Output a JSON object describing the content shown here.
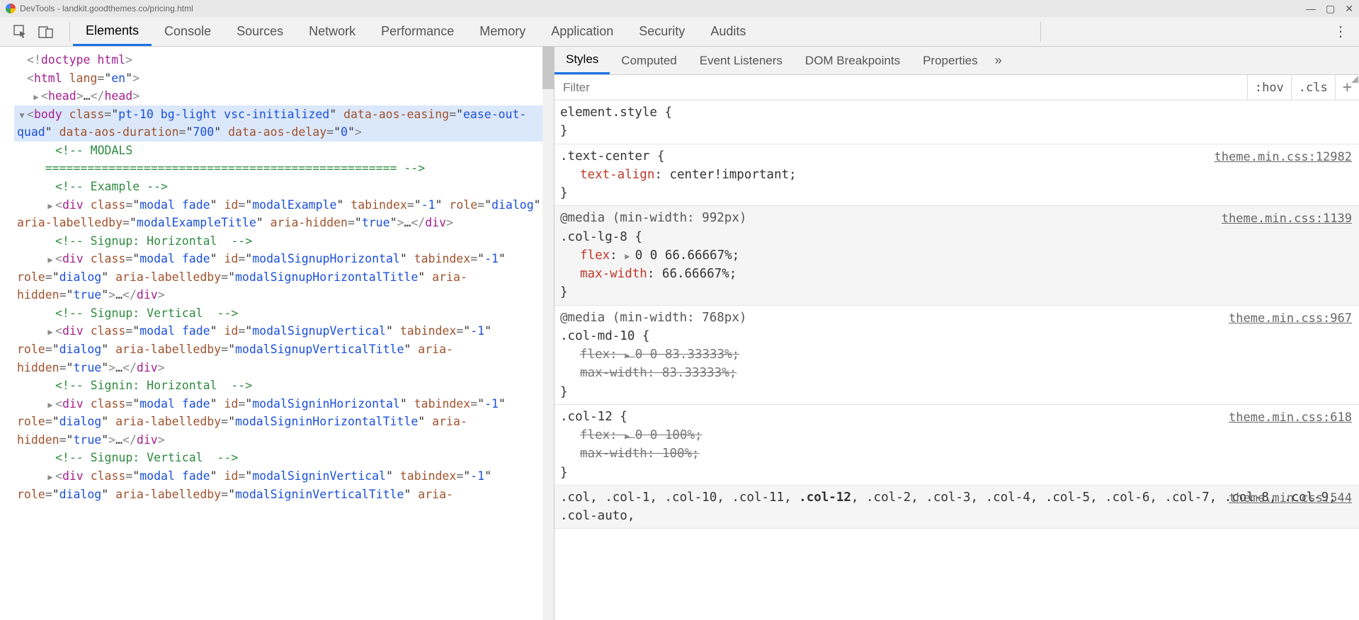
{
  "window": {
    "title": "DevTools - landkit.goodthemes.co/pricing.html",
    "controls": {
      "min": "—",
      "max": "▢",
      "close": "✕"
    }
  },
  "toolbar": {
    "tabs": [
      "Elements",
      "Console",
      "Sources",
      "Network",
      "Performance",
      "Memory",
      "Application",
      "Security",
      "Audits"
    ],
    "active_index": 0
  },
  "elements_panel": {
    "lines": [
      {
        "indent": 0,
        "caret": "",
        "html": "<span class='tok-br'>&lt;!</span><span class='tok-tag'>doctype html</span><span class='tok-br'>&gt;</span>"
      },
      {
        "indent": 0,
        "caret": "",
        "html": "<span class='tok-br'>&lt;</span><span class='tok-tag'>html</span> <span class='tok-attr'>lang</span><span class='tok-eq'>=</span>\"<span class='tok-val'>en</span>\"<span class='tok-br'>&gt;</span>"
      },
      {
        "indent": 1,
        "caret": "▶",
        "html": "<span class='tok-br'>&lt;</span><span class='tok-tag'>head</span><span class='tok-br'>&gt;</span>…<span class='tok-br'>&lt;/</span><span class='tok-tag'>head</span><span class='tok-br'>&gt;</span>"
      },
      {
        "indent": 1,
        "caret": "▼",
        "selected": true,
        "html": "<span class='tok-br'>&lt;</span><span class='tok-tag'>body</span> <span class='tok-attr'>class</span><span class='tok-eq'>=</span>\"<span class='tok-val'>pt-10 bg-light vsc-initialized</span>\" <span class='tok-attr'>data-aos-easing</span><span class='tok-eq'>=</span>\"<span class='tok-val'>ease-out-quad</span>\" <span class='tok-attr'>data-aos-duration</span><span class='tok-eq'>=</span>\"<span class='tok-val'>700</span>\" <span class='tok-attr'>data-aos-delay</span><span class='tok-eq'>=</span>\"<span class='tok-val'>0</span>\"<span class='tok-br'>&gt;</span>"
      },
      {
        "indent": 2,
        "caret": "",
        "html": "<span class='tok-comment'>&lt;!-- MODALS<br>&nbsp;&nbsp;&nbsp;&nbsp;================================================== --&gt;</span>"
      },
      {
        "indent": 2,
        "caret": "",
        "html": "<span class='tok-comment'>&lt;!-- Example --&gt;</span>"
      },
      {
        "indent": 2,
        "caret": "▶",
        "html": "<span class='tok-br'>&lt;</span><span class='tok-tag'>div</span> <span class='tok-attr'>class</span><span class='tok-eq'>=</span>\"<span class='tok-val'>modal fade</span>\" <span class='tok-attr'>id</span><span class='tok-eq'>=</span>\"<span class='tok-val'>modalExample</span>\" <span class='tok-attr'>tabindex</span><span class='tok-eq'>=</span>\"<span class='tok-val'>-1</span>\" <span class='tok-attr'>role</span><span class='tok-eq'>=</span>\"<span class='tok-val'>dialog</span>\" <span class='tok-attr'>aria-labelledby</span><span class='tok-eq'>=</span>\"<span class='tok-val'>modalExampleTitle</span>\" <span class='tok-attr'>aria-hidden</span><span class='tok-eq'>=</span>\"<span class='tok-val'>true</span>\"<span class='tok-br'>&gt;</span>…<span class='tok-br'>&lt;/</span><span class='tok-tag'>div</span><span class='tok-br'>&gt;</span>"
      },
      {
        "indent": 2,
        "caret": "",
        "html": "<span class='tok-comment'>&lt;!-- Signup: Horizontal  --&gt;</span>"
      },
      {
        "indent": 2,
        "caret": "▶",
        "html": "<span class='tok-br'>&lt;</span><span class='tok-tag'>div</span> <span class='tok-attr'>class</span><span class='tok-eq'>=</span>\"<span class='tok-val'>modal fade</span>\" <span class='tok-attr'>id</span><span class='tok-eq'>=</span>\"<span class='tok-val'>modalSignupHorizontal</span>\" <span class='tok-attr'>tabindex</span><span class='tok-eq'>=</span>\"<span class='tok-val'>-1</span>\" <span class='tok-attr'>role</span><span class='tok-eq'>=</span>\"<span class='tok-val'>dialog</span>\" <span class='tok-attr'>aria-labelledby</span><span class='tok-eq'>=</span>\"<span class='tok-val'>modalSignupHorizontalTitle</span>\" <span class='tok-attr'>aria-hidden</span><span class='tok-eq'>=</span>\"<span class='tok-val'>true</span>\"<span class='tok-br'>&gt;</span>…<span class='tok-br'>&lt;/</span><span class='tok-tag'>div</span><span class='tok-br'>&gt;</span>"
      },
      {
        "indent": 2,
        "caret": "",
        "html": "<span class='tok-comment'>&lt;!-- Signup: Vertical  --&gt;</span>"
      },
      {
        "indent": 2,
        "caret": "▶",
        "html": "<span class='tok-br'>&lt;</span><span class='tok-tag'>div</span> <span class='tok-attr'>class</span><span class='tok-eq'>=</span>\"<span class='tok-val'>modal fade</span>\" <span class='tok-attr'>id</span><span class='tok-eq'>=</span>\"<span class='tok-val'>modalSignupVertical</span>\" <span class='tok-attr'>tabindex</span><span class='tok-eq'>=</span>\"<span class='tok-val'>-1</span>\" <span class='tok-attr'>role</span><span class='tok-eq'>=</span>\"<span class='tok-val'>dialog</span>\" <span class='tok-attr'>aria-labelledby</span><span class='tok-eq'>=</span>\"<span class='tok-val'>modalSignupVerticalTitle</span>\" <span class='tok-attr'>aria-hidden</span><span class='tok-eq'>=</span>\"<span class='tok-val'>true</span>\"<span class='tok-br'>&gt;</span>…<span class='tok-br'>&lt;/</span><span class='tok-tag'>div</span><span class='tok-br'>&gt;</span>"
      },
      {
        "indent": 2,
        "caret": "",
        "html": "<span class='tok-comment'>&lt;!-- Signin: Horizontal  --&gt;</span>"
      },
      {
        "indent": 2,
        "caret": "▶",
        "html": "<span class='tok-br'>&lt;</span><span class='tok-tag'>div</span> <span class='tok-attr'>class</span><span class='tok-eq'>=</span>\"<span class='tok-val'>modal fade</span>\" <span class='tok-attr'>id</span><span class='tok-eq'>=</span>\"<span class='tok-val'>modalSigninHorizontal</span>\" <span class='tok-attr'>tabindex</span><span class='tok-eq'>=</span>\"<span class='tok-val'>-1</span>\" <span class='tok-attr'>role</span><span class='tok-eq'>=</span>\"<span class='tok-val'>dialog</span>\" <span class='tok-attr'>aria-labelledby</span><span class='tok-eq'>=</span>\"<span class='tok-val'>modalSigninHorizontalTitle</span>\" <span class='tok-attr'>aria-hidden</span><span class='tok-eq'>=</span>\"<span class='tok-val'>true</span>\"<span class='tok-br'>&gt;</span>…<span class='tok-br'>&lt;/</span><span class='tok-tag'>div</span><span class='tok-br'>&gt;</span>"
      },
      {
        "indent": 2,
        "caret": "",
        "html": "<span class='tok-comment'>&lt;!-- Signup: Vertical  --&gt;</span>"
      },
      {
        "indent": 2,
        "caret": "▶",
        "html": "<span class='tok-br'>&lt;</span><span class='tok-tag'>div</span> <span class='tok-attr'>class</span><span class='tok-eq'>=</span>\"<span class='tok-val'>modal fade</span>\" <span class='tok-attr'>id</span><span class='tok-eq'>=</span>\"<span class='tok-val'>modalSigninVertical</span>\" <span class='tok-attr'>tabindex</span><span class='tok-eq'>=</span>\"<span class='tok-val'>-1</span>\" <span class='tok-attr'>role</span><span class='tok-eq'>=</span>\"<span class='tok-val'>dialog</span>\" <span class='tok-attr'>aria-labelledby</span><span class='tok-eq'>=</span>\"<span class='tok-val'>modalSigninVerticalTitle</span>\" <span class='tok-attr'>aria-"
      }
    ]
  },
  "styles_panel": {
    "tabs": [
      "Styles",
      "Computed",
      "Event Listeners",
      "DOM Breakpoints",
      "Properties"
    ],
    "active_index": 0,
    "filter_placeholder": "Filter",
    "hov": ":hov",
    "cls": ".cls",
    "plus": "+"
  },
  "style_rules": [
    {
      "shaded": false,
      "source": "",
      "selector": "element.style {",
      "props": [],
      "close": "}"
    },
    {
      "shaded": false,
      "source": "theme.min.css:12982",
      "selector": ".text-center {",
      "props": [
        {
          "n": "text-align",
          "v": "center!important;",
          "struck": false
        }
      ],
      "close": "}"
    },
    {
      "shaded": true,
      "source": "theme.min.css:1139",
      "media": "@media (min-width: 992px)",
      "selector": ".col-lg-8 {",
      "props": [
        {
          "n": "flex",
          "v": "0 0 66.66667%;",
          "struck": false,
          "expand": true
        },
        {
          "n": "max-width",
          "v": "66.66667%;",
          "struck": false
        }
      ],
      "close": "}"
    },
    {
      "shaded": false,
      "source": "theme.min.css:967",
      "media": "@media (min-width: 768px)",
      "selector": ".col-md-10 {",
      "props": [
        {
          "n": "flex",
          "v": "0 0 83.33333%;",
          "struck": true,
          "expand": true
        },
        {
          "n": "max-width",
          "v": "83.33333%;",
          "struck": true
        }
      ],
      "close": "}"
    },
    {
      "shaded": false,
      "source": "theme.min.css:618",
      "selector": ".col-12 {",
      "props": [
        {
          "n": "flex",
          "v": "0 0 100%;",
          "struck": true,
          "expand": true
        },
        {
          "n": "max-width",
          "v": "100%;",
          "struck": true
        }
      ],
      "close": "}"
    },
    {
      "shaded": true,
      "source": "theme.min.css:544",
      "selector_html": ".col, .col-1, .col-10, .col-11, <b>.col-12</b>, .col-2, .col-3, .col-4, .col-5, .col-6, .col-7, .col-8, .col-9, .col-auto,"
    }
  ]
}
